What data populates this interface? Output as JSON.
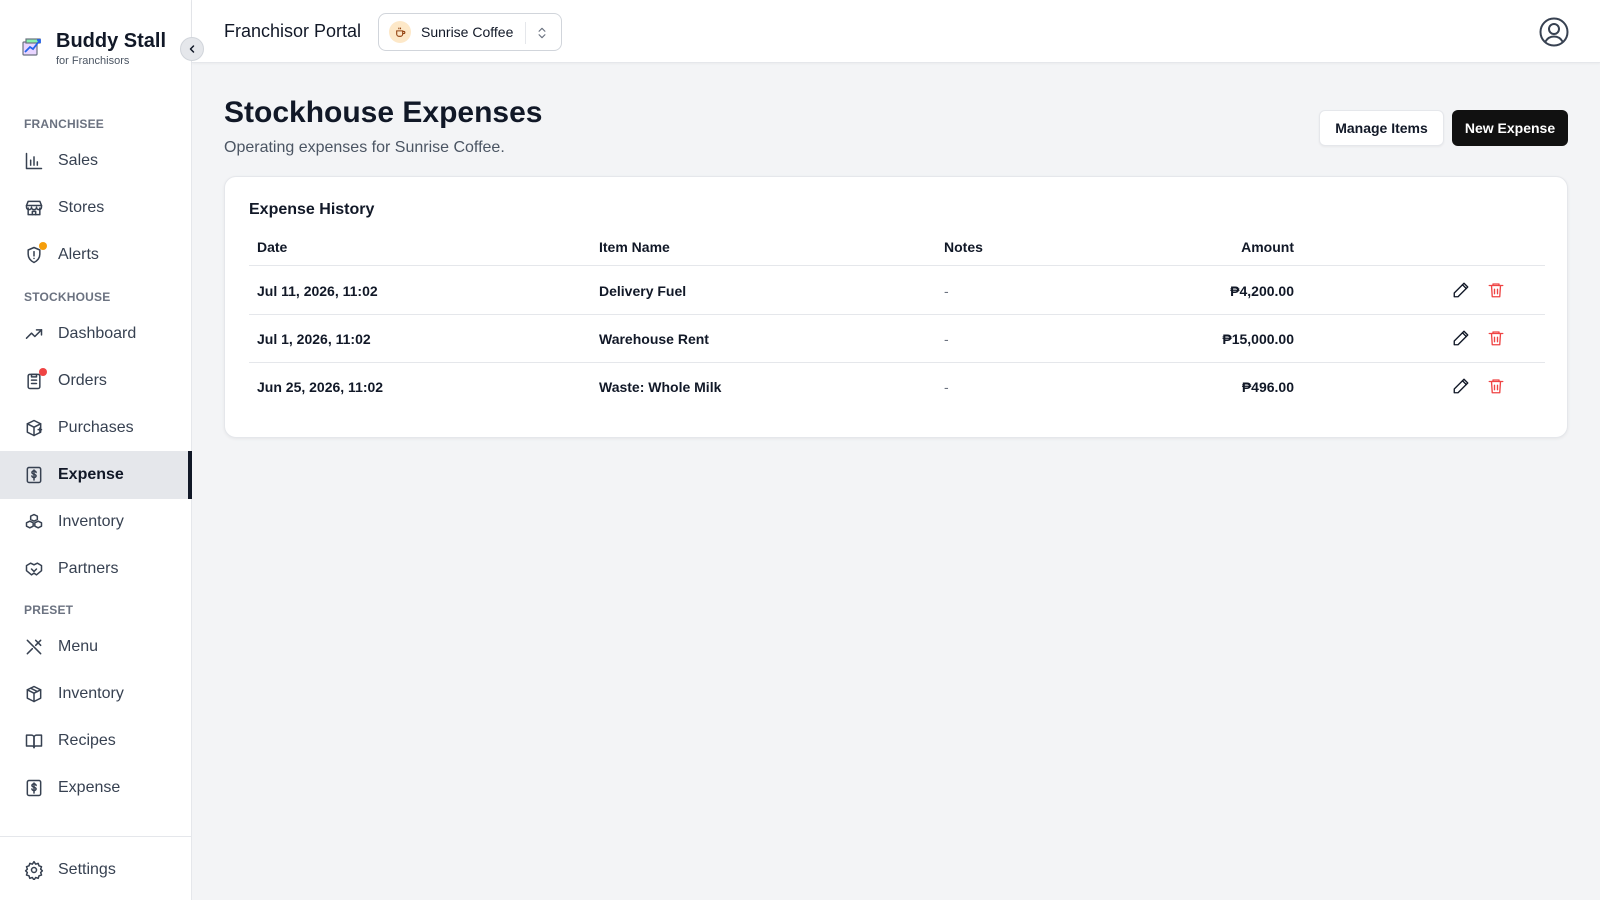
{
  "brand": {
    "title": "Buddy Stall",
    "subtitle": "for Franchisors"
  },
  "sidebar": {
    "sections": [
      {
        "label": "FRANCHISEE",
        "items": [
          {
            "label": "Sales",
            "icon": "bar-chart-icon"
          },
          {
            "label": "Stores",
            "icon": "store-icon"
          },
          {
            "label": "Alerts",
            "icon": "alert-shield-icon",
            "badge_color": "#f59e0b"
          }
        ]
      },
      {
        "label": "STOCKHOUSE",
        "items": [
          {
            "label": "Dashboard",
            "icon": "trending-up-icon"
          },
          {
            "label": "Orders",
            "icon": "clipboard-list-icon",
            "badge_color": "#ef4444"
          },
          {
            "label": "Purchases",
            "icon": "package-plus-icon"
          },
          {
            "label": "Expense",
            "icon": "receipt-dollar-icon",
            "active": true
          },
          {
            "label": "Inventory",
            "icon": "boxes-icon"
          },
          {
            "label": "Partners",
            "icon": "handshake-icon"
          }
        ]
      },
      {
        "label": "PRESET",
        "items": [
          {
            "label": "Menu",
            "icon": "utensils-crossed-icon"
          },
          {
            "label": "Inventory",
            "icon": "package-icon"
          },
          {
            "label": "Recipes",
            "icon": "book-open-icon"
          },
          {
            "label": "Expense",
            "icon": "receipt-dollar-icon"
          }
        ]
      }
    ],
    "settings_label": "Settings"
  },
  "topbar": {
    "portal_title": "Franchisor Portal",
    "store_name": "Sunrise Coffee"
  },
  "page": {
    "title": "Stockhouse Expenses",
    "subtitle": "Operating expenses for Sunrise Coffee.",
    "manage_items_label": "Manage Items",
    "new_expense_label": "New Expense"
  },
  "expense_history": {
    "title": "Expense History",
    "columns": {
      "date": "Date",
      "item": "Item Name",
      "notes": "Notes",
      "amount": "Amount"
    },
    "rows": [
      {
        "date": "Jul 11, 2026, 11:02",
        "item": "Delivery Fuel",
        "notes": "-",
        "amount": "₱4,200.00"
      },
      {
        "date": "Jul 1, 2026, 11:02",
        "item": "Warehouse Rent",
        "notes": "-",
        "amount": "₱15,000.00"
      },
      {
        "date": "Jun 25, 2026, 11:02",
        "item": "Waste: Whole Milk",
        "notes": "-",
        "amount": "₱496.00"
      }
    ]
  },
  "colors": {
    "accent": "#111111",
    "delete": "#ef4444",
    "active_bg": "#e5e7eb"
  }
}
